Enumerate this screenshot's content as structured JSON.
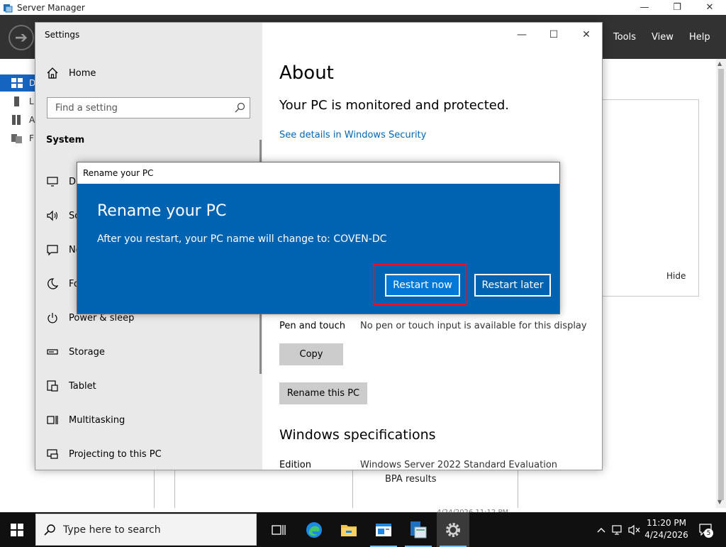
{
  "server_manager": {
    "title": "Server Manager",
    "menu": {
      "tools": "Tools",
      "view": "View",
      "help": "Help"
    },
    "nav": [
      {
        "label": "D",
        "icon": "dashboard-icon",
        "active": true
      },
      {
        "label": "L",
        "icon": "local-server-icon"
      },
      {
        "label": "A",
        "icon": "all-servers-icon"
      },
      {
        "label": "F",
        "icon": "file-services-icon"
      }
    ],
    "hide_label": "Hide",
    "bpa_label": "BPA results",
    "timestamp": "4/24/2026 11:12 PM"
  },
  "settings": {
    "title": "Settings",
    "home_label": "Home",
    "search": {
      "placeholder": "Find a setting"
    },
    "section_label": "System",
    "nav": [
      {
        "label": "Di",
        "icon": "display-icon"
      },
      {
        "label": "So",
        "icon": "sound-icon"
      },
      {
        "label": "No",
        "icon": "notifications-icon"
      },
      {
        "label": "Fo",
        "icon": "focus-assist-icon"
      },
      {
        "label": "Power & sleep",
        "icon": "power-icon"
      },
      {
        "label": "Storage",
        "icon": "storage-icon"
      },
      {
        "label": "Tablet",
        "icon": "tablet-icon"
      },
      {
        "label": "Multitasking",
        "icon": "multitasking-icon"
      },
      {
        "label": "Projecting to this PC",
        "icon": "projecting-icon"
      }
    ],
    "about": {
      "heading": "About",
      "protection": "Your PC is monitored and protected.",
      "security_link": "See details in Windows Security",
      "pen_touch_label": "Pen and touch",
      "pen_touch_value": "No pen or touch input is available for this display",
      "copy_button": "Copy",
      "rename_button": "Rename this PC",
      "spec_heading": "Windows specifications",
      "edition_label": "Edition",
      "edition_value": "Windows Server 2022 Standard Evaluation"
    }
  },
  "rename_dialog": {
    "window_title": "Rename your PC",
    "heading": "Rename your PC",
    "message": "After you restart, your PC name will change to: COVEN-DC",
    "restart_now": "Restart now",
    "restart_later": "Restart later",
    "highlight_color": "#e81123"
  },
  "taskbar": {
    "search_placeholder": "Type here to search",
    "apps": [
      "task-view-icon",
      "edge-icon",
      "file-explorer-icon",
      "server-manager-icon",
      "server-manager-app-icon",
      "settings-icon"
    ],
    "time": "11:20 PM",
    "date": "4/24/2026",
    "notification_count": "5"
  },
  "colors": {
    "accent": "#0063b1",
    "accent_button": "#0078d7",
    "link": "#0067b8",
    "header_dark": "#323232",
    "taskbar": "#101010"
  }
}
